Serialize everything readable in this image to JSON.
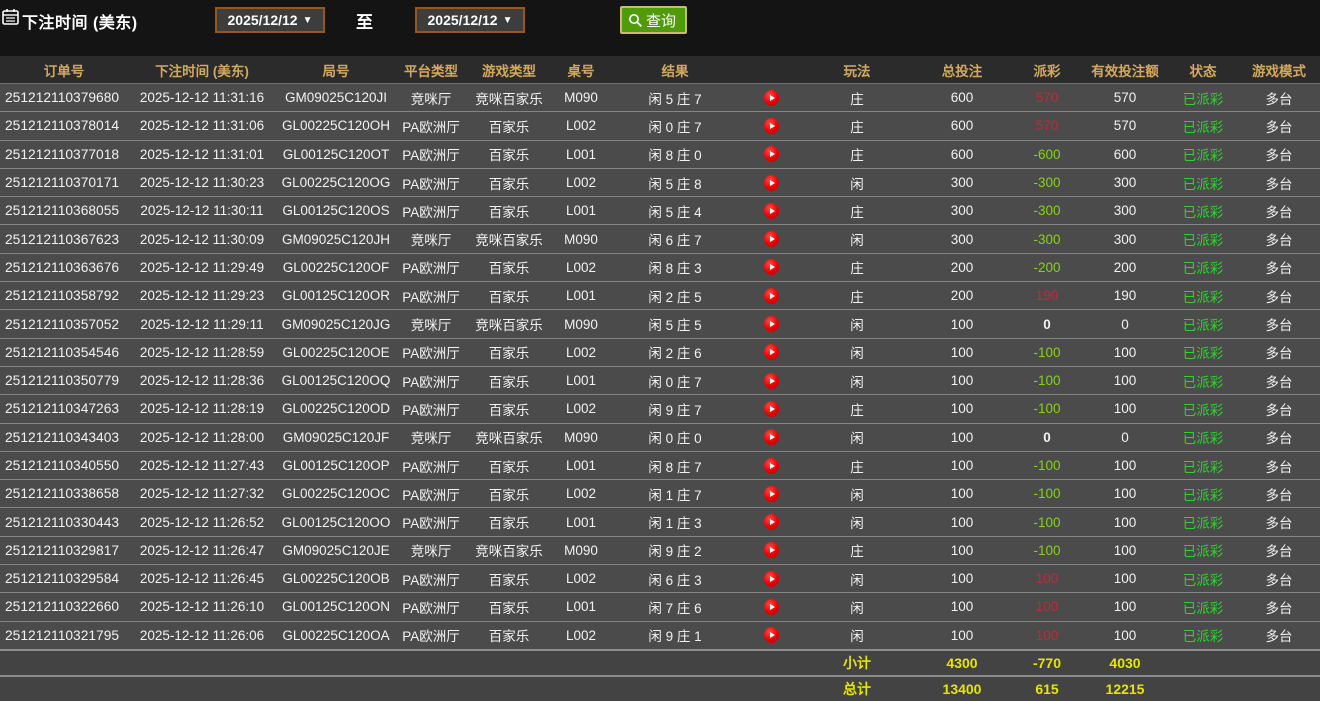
{
  "toolbar": {
    "title": "下注时间 (美东)",
    "date_from": "2025/12/12",
    "date_to": "2025/12/12",
    "to_label": "至",
    "query_label": "查询",
    "dropdown_arrow": "▼"
  },
  "icons": {
    "calendar": "calendar-icon",
    "search": "search-icon",
    "play": "play-icon"
  },
  "colors": {
    "page_background": "#141414",
    "header_background": "#2b2b2b",
    "row_background": "#4b4b4b",
    "header_gold": "#d2a95f",
    "positive_payout_red": "#c02a3a",
    "negative_payout_green": "#85d414",
    "status_green": "#2fd32f",
    "totals_yellow": "#e6e600",
    "query_button_green": "#4f9b0a",
    "date_border_brown": "#96581c",
    "play_icon_red": "#e60000"
  },
  "table": {
    "columns": [
      "订单号",
      "下注时间 (美东)",
      "局号",
      "平台类型",
      "游戏类型",
      "桌号",
      "结果",
      "",
      "玩法",
      "总投注",
      "派彩",
      "有效投注额",
      "状态",
      "游戏模式"
    ],
    "rows": [
      {
        "order": "251212110379680",
        "time": "2025-12-12 11:31:16",
        "round": "GM09025C120JI",
        "platform": "竞咪厅",
        "game": "竞咪百家乐",
        "table": "M090",
        "result": "闲 5 庄 7",
        "bet_on": "庄",
        "bet": "600",
        "payout": "570",
        "payout_sign": "pos",
        "valid": "570",
        "status": "已派彩",
        "mode": "多台"
      },
      {
        "order": "251212110378014",
        "time": "2025-12-12 11:31:06",
        "round": "GL00225C120OH",
        "platform": "PA欧洲厅",
        "game": "百家乐",
        "table": "L002",
        "result": "闲 0 庄 7",
        "bet_on": "庄",
        "bet": "600",
        "payout": "570",
        "payout_sign": "pos",
        "valid": "570",
        "status": "已派彩",
        "mode": "多台"
      },
      {
        "order": "251212110377018",
        "time": "2025-12-12 11:31:01",
        "round": "GL00125C120OT",
        "platform": "PA欧洲厅",
        "game": "百家乐",
        "table": "L001",
        "result": "闲 8 庄 0",
        "bet_on": "庄",
        "bet": "600",
        "payout": "-600",
        "payout_sign": "neg",
        "valid": "600",
        "status": "已派彩",
        "mode": "多台"
      },
      {
        "order": "251212110370171",
        "time": "2025-12-12 11:30:23",
        "round": "GL00225C120OG",
        "platform": "PA欧洲厅",
        "game": "百家乐",
        "table": "L002",
        "result": "闲 5 庄 8",
        "bet_on": "闲",
        "bet": "300",
        "payout": "-300",
        "payout_sign": "neg",
        "valid": "300",
        "status": "已派彩",
        "mode": "多台"
      },
      {
        "order": "251212110368055",
        "time": "2025-12-12 11:30:11",
        "round": "GL00125C120OS",
        "platform": "PA欧洲厅",
        "game": "百家乐",
        "table": "L001",
        "result": "闲 5 庄 4",
        "bet_on": "庄",
        "bet": "300",
        "payout": "-300",
        "payout_sign": "neg",
        "valid": "300",
        "status": "已派彩",
        "mode": "多台"
      },
      {
        "order": "251212110367623",
        "time": "2025-12-12 11:30:09",
        "round": "GM09025C120JH",
        "platform": "竞咪厅",
        "game": "竞咪百家乐",
        "table": "M090",
        "result": "闲 6 庄 7",
        "bet_on": "闲",
        "bet": "300",
        "payout": "-300",
        "payout_sign": "neg",
        "valid": "300",
        "status": "已派彩",
        "mode": "多台"
      },
      {
        "order": "251212110363676",
        "time": "2025-12-12 11:29:49",
        "round": "GL00225C120OF",
        "platform": "PA欧洲厅",
        "game": "百家乐",
        "table": "L002",
        "result": "闲 8 庄 3",
        "bet_on": "庄",
        "bet": "200",
        "payout": "-200",
        "payout_sign": "neg",
        "valid": "200",
        "status": "已派彩",
        "mode": "多台"
      },
      {
        "order": "251212110358792",
        "time": "2025-12-12 11:29:23",
        "round": "GL00125C120OR",
        "platform": "PA欧洲厅",
        "game": "百家乐",
        "table": "L001",
        "result": "闲 2 庄 5",
        "bet_on": "庄",
        "bet": "200",
        "payout": "190",
        "payout_sign": "pos",
        "valid": "190",
        "status": "已派彩",
        "mode": "多台"
      },
      {
        "order": "251212110357052",
        "time": "2025-12-12 11:29:11",
        "round": "GM09025C120JG",
        "platform": "竞咪厅",
        "game": "竞咪百家乐",
        "table": "M090",
        "result": "闲 5 庄 5",
        "bet_on": "闲",
        "bet": "100",
        "payout": "0",
        "payout_sign": "zero",
        "valid": "0",
        "status": "已派彩",
        "mode": "多台"
      },
      {
        "order": "251212110354546",
        "time": "2025-12-12 11:28:59",
        "round": "GL00225C120OE",
        "platform": "PA欧洲厅",
        "game": "百家乐",
        "table": "L002",
        "result": "闲 2 庄 6",
        "bet_on": "闲",
        "bet": "100",
        "payout": "-100",
        "payout_sign": "neg",
        "valid": "100",
        "status": "已派彩",
        "mode": "多台"
      },
      {
        "order": "251212110350779",
        "time": "2025-12-12 11:28:36",
        "round": "GL00125C120OQ",
        "platform": "PA欧洲厅",
        "game": "百家乐",
        "table": "L001",
        "result": "闲 0 庄 7",
        "bet_on": "闲",
        "bet": "100",
        "payout": "-100",
        "payout_sign": "neg",
        "valid": "100",
        "status": "已派彩",
        "mode": "多台"
      },
      {
        "order": "251212110347263",
        "time": "2025-12-12 11:28:19",
        "round": "GL00225C120OD",
        "platform": "PA欧洲厅",
        "game": "百家乐",
        "table": "L002",
        "result": "闲 9 庄 7",
        "bet_on": "庄",
        "bet": "100",
        "payout": "-100",
        "payout_sign": "neg",
        "valid": "100",
        "status": "已派彩",
        "mode": "多台"
      },
      {
        "order": "251212110343403",
        "time": "2025-12-12 11:28:00",
        "round": "GM09025C120JF",
        "platform": "竞咪厅",
        "game": "竞咪百家乐",
        "table": "M090",
        "result": "闲 0 庄 0",
        "bet_on": "闲",
        "bet": "100",
        "payout": "0",
        "payout_sign": "zero",
        "valid": "0",
        "status": "已派彩",
        "mode": "多台"
      },
      {
        "order": "251212110340550",
        "time": "2025-12-12 11:27:43",
        "round": "GL00125C120OP",
        "platform": "PA欧洲厅",
        "game": "百家乐",
        "table": "L001",
        "result": "闲 8 庄 7",
        "bet_on": "庄",
        "bet": "100",
        "payout": "-100",
        "payout_sign": "neg",
        "valid": "100",
        "status": "已派彩",
        "mode": "多台"
      },
      {
        "order": "251212110338658",
        "time": "2025-12-12 11:27:32",
        "round": "GL00225C120OC",
        "platform": "PA欧洲厅",
        "game": "百家乐",
        "table": "L002",
        "result": "闲 1 庄 7",
        "bet_on": "闲",
        "bet": "100",
        "payout": "-100",
        "payout_sign": "neg",
        "valid": "100",
        "status": "已派彩",
        "mode": "多台"
      },
      {
        "order": "251212110330443",
        "time": "2025-12-12 11:26:52",
        "round": "GL00125C120OO",
        "platform": "PA欧洲厅",
        "game": "百家乐",
        "table": "L001",
        "result": "闲 1 庄 3",
        "bet_on": "闲",
        "bet": "100",
        "payout": "-100",
        "payout_sign": "neg",
        "valid": "100",
        "status": "已派彩",
        "mode": "多台"
      },
      {
        "order": "251212110329817",
        "time": "2025-12-12 11:26:47",
        "round": "GM09025C120JE",
        "platform": "竞咪厅",
        "game": "竞咪百家乐",
        "table": "M090",
        "result": "闲 9 庄 2",
        "bet_on": "庄",
        "bet": "100",
        "payout": "-100",
        "payout_sign": "neg",
        "valid": "100",
        "status": "已派彩",
        "mode": "多台"
      },
      {
        "order": "251212110329584",
        "time": "2025-12-12 11:26:45",
        "round": "GL00225C120OB",
        "platform": "PA欧洲厅",
        "game": "百家乐",
        "table": "L002",
        "result": "闲 6 庄 3",
        "bet_on": "闲",
        "bet": "100",
        "payout": "100",
        "payout_sign": "pos",
        "valid": "100",
        "status": "已派彩",
        "mode": "多台"
      },
      {
        "order": "251212110322660",
        "time": "2025-12-12 11:26:10",
        "round": "GL00125C120ON",
        "platform": "PA欧洲厅",
        "game": "百家乐",
        "table": "L001",
        "result": "闲 7 庄 6",
        "bet_on": "闲",
        "bet": "100",
        "payout": "100",
        "payout_sign": "pos",
        "valid": "100",
        "status": "已派彩",
        "mode": "多台"
      },
      {
        "order": "251212110321795",
        "time": "2025-12-12 11:26:06",
        "round": "GL00225C120OA",
        "platform": "PA欧洲厅",
        "game": "百家乐",
        "table": "L002",
        "result": "闲 9 庄 1",
        "bet_on": "闲",
        "bet": "100",
        "payout": "100",
        "payout_sign": "pos",
        "valid": "100",
        "status": "已派彩",
        "mode": "多台"
      }
    ],
    "footer": {
      "subtotal": {
        "label": "小计",
        "bet": "4300",
        "payout": "-770",
        "valid": "4030"
      },
      "total": {
        "label": "总计",
        "bet": "13400",
        "payout": "615",
        "valid": "12215"
      }
    }
  }
}
